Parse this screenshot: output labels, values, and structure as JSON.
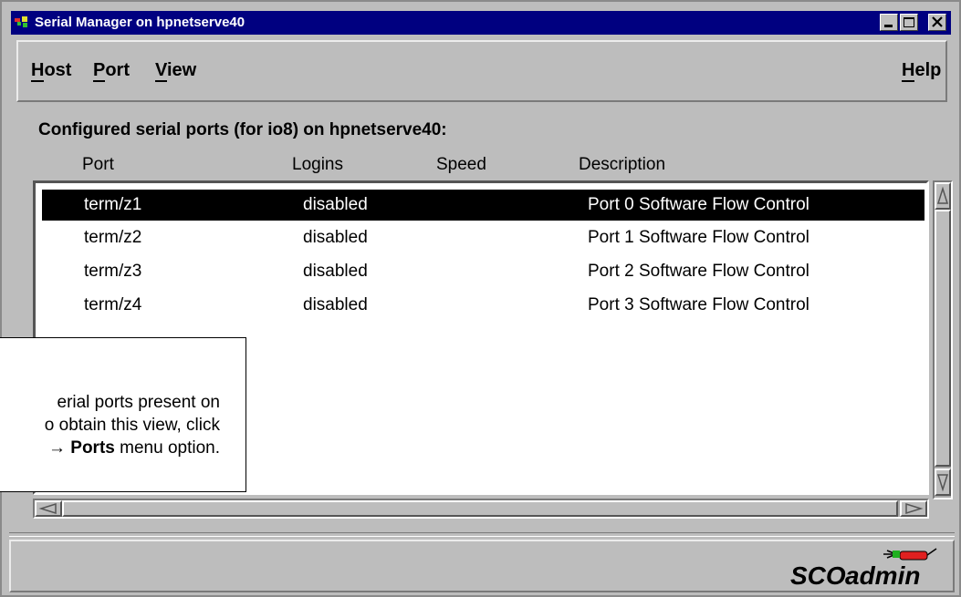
{
  "window": {
    "title": "Serial Manager on hpnetserve40",
    "controls": [
      "minimize",
      "maximize",
      "close"
    ]
  },
  "menubar": {
    "items": [
      {
        "label": "Host",
        "mnemonic": "H"
      },
      {
        "label": "Port",
        "mnemonic": "P"
      },
      {
        "label": "View",
        "mnemonic": "V"
      }
    ],
    "help": {
      "label": "Help",
      "mnemonic": "H"
    }
  },
  "main": {
    "heading": "Configured serial ports (for io8) on hpnetserve40:",
    "columns": [
      "Port",
      "Logins",
      "Speed",
      "Description"
    ],
    "rows": [
      {
        "port": "term/z1",
        "logins": "disabled",
        "speed": "",
        "description": "Port 0 Software Flow Control",
        "selected": true
      },
      {
        "port": "term/z2",
        "logins": "disabled",
        "speed": "",
        "description": "Port 1 Software Flow Control",
        "selected": false
      },
      {
        "port": "term/z3",
        "logins": "disabled",
        "speed": "",
        "description": "Port 2 Software Flow Control",
        "selected": false
      },
      {
        "port": "term/z4",
        "logins": "disabled",
        "speed": "",
        "description": "Port 3 Software Flow Control",
        "selected": false
      }
    ]
  },
  "callout": {
    "line1": "erial ports present on",
    "line2": "o obtain this view, click",
    "line3_arrow": "→",
    "line3_bold": "Ports",
    "line3_rest": " menu option."
  },
  "status": {
    "logo_sco": "SCO",
    "logo_admin": "admin"
  },
  "colors": {
    "titlebar": "#000080",
    "selection": "#000000",
    "window_bg": "#bdbdbd"
  },
  "icons": [
    "app-icon",
    "minimize-icon",
    "maximize-icon",
    "close-icon",
    "scroll-up-icon",
    "scroll-down-icon",
    "scroll-left-icon",
    "scroll-right-icon",
    "sco-admin-logo"
  ]
}
